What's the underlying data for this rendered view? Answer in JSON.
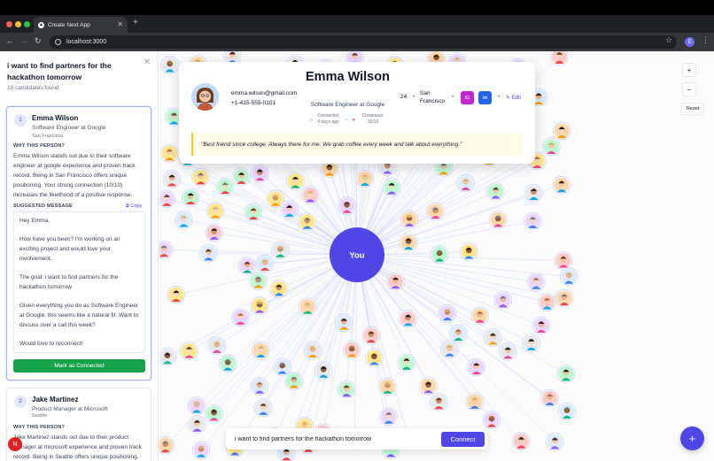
{
  "browser": {
    "tab_title": "Create Next App",
    "url": "localhost:3000",
    "profile_initial": "E"
  },
  "sidebar": {
    "query": "i want to find partners for the hackathon tomorrow",
    "count": "10 candidates found",
    "why_label": "WHY THIS PERSON?",
    "suggested_label": "SUGGESTED MESSAGE",
    "copy_label": "Copy",
    "candidates": [
      {
        "rank": "1",
        "name": "Emma Wilson",
        "role": "Software Engineer at Google",
        "city": "San Francisco",
        "reason": "Emma Wilson stands out due to their software engineer at google experience and proven track record. Being in San Francisco offers unique positioning. Your strong connection (10/10) increases the likelihood of a positive response.",
        "message": [
          "Hey Emma,",
          "How have you been? I'm working on an exciting project and would love your involvement.",
          "The goal: i want to find partners for the hackathon tomorrow",
          "Given everything you do as Software Engineer at Google, this seems like a natural fit. Want to discuss over a call this week?",
          "Would love to reconnect!"
        ],
        "action": "Mark as Connected"
      },
      {
        "rank": "2",
        "name": "Jake Martinez",
        "role": "Product Manager at Microsoft",
        "city": "Seattle",
        "reason": "Jake Martinez stands out due to their product manager at microsoft experience and proven track record. Being in Seattle offers unique positioning."
      }
    ],
    "user_initial": "N"
  },
  "profile": {
    "name": "Emma Wilson",
    "email": "emma.wilson@gmail.com",
    "phone": "+1-415-555-0101",
    "role": "Software Engineer at Google",
    "connected_label": "Connected",
    "connected_value": "4 days ago",
    "closeness_label": "Closeness:",
    "closeness_value": "10/10",
    "age": "24",
    "city": "San Francisco",
    "instagram": "IG",
    "linkedin": "in",
    "edit": "Edit",
    "quote": "\"Best friend since college. Always there for me. We grab coffee every week and talk about everything.\""
  },
  "graph": {
    "center_label": "You",
    "zoom_in": "+",
    "zoom_out": "−",
    "reset": "Reset",
    "fab": "+"
  },
  "search": {
    "value": "i want to find partners for the hackathon tomorrow",
    "button": "Connect"
  },
  "colors": {
    "accent": "#4f46e5",
    "success": "#16a34a",
    "instagram": "#c026d3",
    "linkedin": "#2563eb"
  }
}
